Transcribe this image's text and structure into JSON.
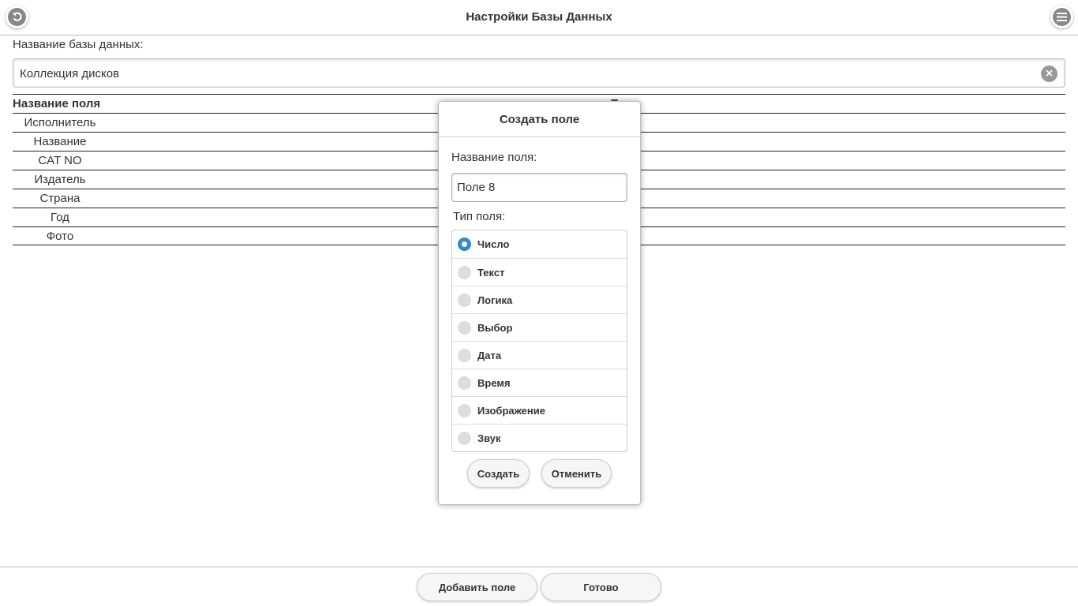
{
  "header": {
    "title": "Настройки Базы Данных",
    "back_icon": "back-icon",
    "menu_icon": "menu-icon"
  },
  "db_name": {
    "label": "Название базы данных:",
    "value": "Коллекция дисков"
  },
  "table": {
    "columns": [
      "Название поля",
      "Тип"
    ],
    "rows": [
      "Исполнитель",
      "Название",
      "CAT NO",
      "Издатель",
      "Страна",
      "Год",
      "Фото"
    ]
  },
  "dialog": {
    "title": "Создать поле",
    "field_label": "Название поля:",
    "field_value": "Поле 8",
    "type_label": "Тип поля:",
    "types": [
      "Число",
      "Текст",
      "Логика",
      "Выбор",
      "Дата",
      "Время",
      "Изображение",
      "Звук"
    ],
    "selected": "Число",
    "accent": "#3388cc",
    "create": "Создать",
    "cancel": "Отменить"
  },
  "footer": {
    "add": "Добавить поле",
    "done": "Готово"
  }
}
